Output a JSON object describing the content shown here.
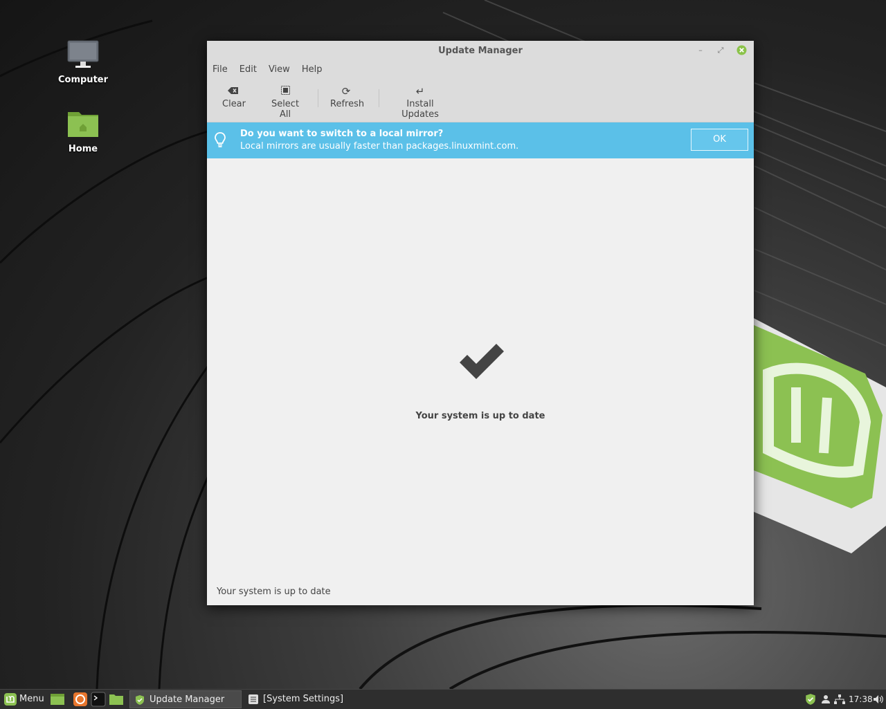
{
  "desktop": {
    "icons": [
      {
        "label": "Computer"
      },
      {
        "label": "Home"
      }
    ]
  },
  "window": {
    "title": "Update Manager",
    "menu": [
      "File",
      "Edit",
      "View",
      "Help"
    ],
    "toolbar": {
      "clear": "Clear",
      "select_all": "Select All",
      "refresh": "Refresh",
      "install": "Install Updates"
    },
    "infobar": {
      "title": "Do you want to switch to a local mirror?",
      "message": "Local mirrors are usually faster than packages.linuxmint.com.",
      "ok_label": "OK",
      "color": "#5bc0e8"
    },
    "main_message": "Your system is up to date",
    "status_text": "Your system is up to date"
  },
  "taskbar": {
    "menu_label": "Menu",
    "tasks": [
      {
        "label": "Update Manager",
        "active": true
      },
      {
        "label": "[System Settings]",
        "active": false
      }
    ],
    "clock": "17:38"
  },
  "colors": {
    "mint_green": "#8cc152",
    "close_green": "#8bc34a"
  }
}
